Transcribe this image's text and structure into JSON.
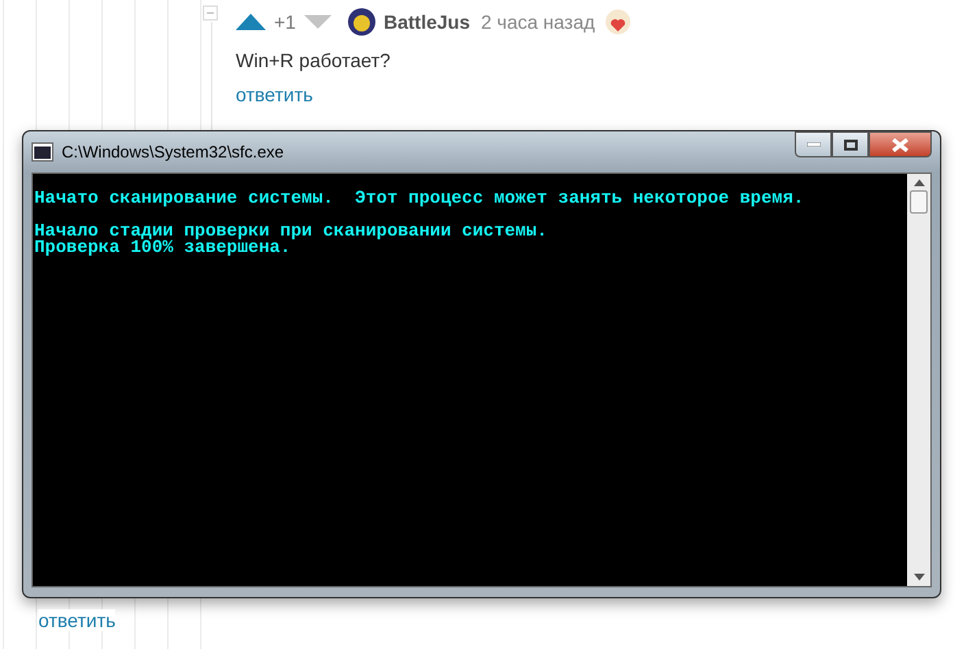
{
  "comment": {
    "score": "+1",
    "author": "BattleJus",
    "time": "2 часа назад",
    "text": "Win+R работает?",
    "reply": "ответить"
  },
  "console_window": {
    "title": "C:\\Windows\\System32\\sfc.exe",
    "paragraphs": [
      [
        "Начато сканирование системы.  Этот процесс может занять некоторое время."
      ],
      [
        "Начало стадии проверки при сканировании системы.",
        "Проверка 100% завершена."
      ]
    ]
  },
  "reply_link": "ответить"
}
